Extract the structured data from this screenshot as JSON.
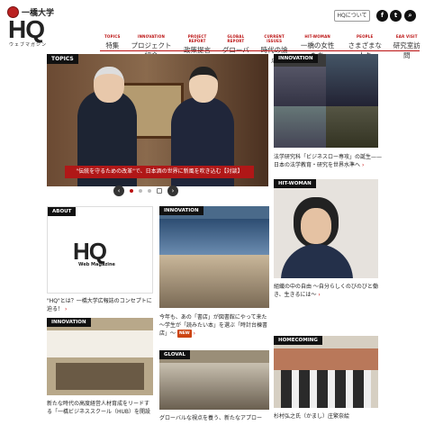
{
  "header": {
    "university": "一橋大学",
    "logo": "HQ",
    "logo_sub": "ウェブマガジン",
    "about_button": "HQについて",
    "social": [
      "f",
      "t",
      "search-icon"
    ]
  },
  "nav": [
    {
      "en": "TOPICS",
      "jp": "特集"
    },
    {
      "en": "INNOVATION",
      "jp": "プロジェクト紹介"
    },
    {
      "en": "PROJECT REPORT",
      "jp": "政策提言"
    },
    {
      "en": "GLOBAL REPORT",
      "jp": "グローバル"
    },
    {
      "en": "CURRENT ISSUES",
      "jp": "時代の論点"
    },
    {
      "en": "HIT-WOMAN",
      "jp": "一橋の女性たち"
    },
    {
      "en": "PEOPLE",
      "jp": "さまざまな人々"
    },
    {
      "en": "EAR VISIT",
      "jp": "研究室訪問"
    }
  ],
  "hero": {
    "tag": "TOPICS",
    "caption": "\"伝統を守るための改革\"で、日本酒の世界に新風を吹き込む【対談】"
  },
  "cards": {
    "innovation_top": {
      "tag": "INNOVATION",
      "text": "法学研究科「ビジネスロー専攻」の誕生——日本の法学教育・研究を世界水準へ"
    },
    "about": {
      "tag": "ABOUT",
      "logo": "HQ",
      "logo_sub": "Web Magazine",
      "text": "\"HQ\"とは？一橋大学広報誌のコンセプトに迫る！"
    },
    "innovation_mid": {
      "tag": "INNOVATION",
      "text": "今年も、あの「書店」が図書館にやって来た～学生が「読みたい本」を選ぶ「時計台棟書店」～",
      "badge": "NEW"
    },
    "hitwoman": {
      "tag": "HIT-WOMAN",
      "text": "組織の中の自由 ～自分らしくのびのびと働き、生きるには～"
    },
    "innovation_bottom": {
      "tag": "INNOVATION",
      "text": "新たな時代の高度経営人材育成をリードする「一橋ビジネススクール（HUB）を開設"
    },
    "global": {
      "tag": "GLOVAL",
      "text": "グローバルな視点を養う、新たなアプロー"
    },
    "homecoming": {
      "tag": "HOMECOMING",
      "text": "杉村弘之氏（かまし）庄繁奈絵"
    }
  }
}
